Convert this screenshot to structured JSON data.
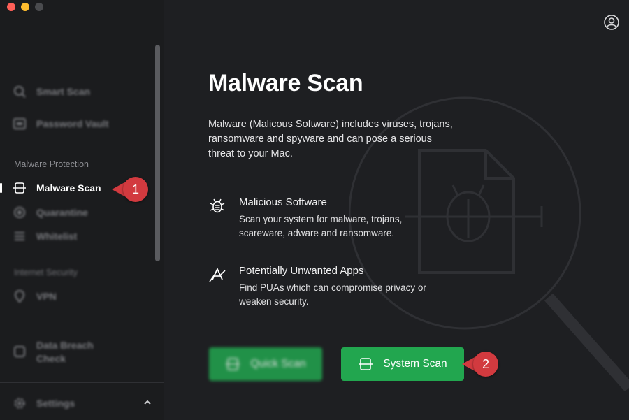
{
  "sidebar": {
    "top_items": [
      {
        "label": "Smart Scan",
        "icon": "search-icon"
      },
      {
        "label": "Password Vault",
        "icon": "vault-icon"
      }
    ],
    "section_malware": "Malware Protection",
    "malware_items": [
      {
        "label": "Malware Scan",
        "icon": "scanner-icon",
        "active": true
      },
      {
        "label": "Quarantine",
        "icon": "quarantine-icon"
      },
      {
        "label": "Whitelist",
        "icon": "list-icon"
      }
    ],
    "section_internet": "Internet Security",
    "internet_items": [
      {
        "label": "VPN",
        "icon": "location-pin-icon"
      }
    ],
    "breach_item": {
      "label_line1": "Data Breach",
      "label_line2": "Check",
      "icon": "breach-icon"
    },
    "settings": {
      "label": "Settings",
      "icon": "gear-icon",
      "toggle_icon": "chevron-up-icon"
    }
  },
  "main": {
    "title": "Malware Scan",
    "description": "Malware (Malicous Software) includes viruses, trojans, ransomware and spyware and can pose a serious threat to your Mac.",
    "features": [
      {
        "icon": "bug-icon",
        "title": "Malicious Software",
        "description": "Scan your system for malware, trojans, scareware, adware and ransomware."
      },
      {
        "icon": "app-warning-icon",
        "title": "Potentially Unwanted Apps",
        "description": "Find PUAs which can compromise privacy or weaken security."
      }
    ],
    "buttons": {
      "quick_scan": "Quick Scan",
      "system_scan": "System Scan"
    }
  },
  "callouts": {
    "first": "1",
    "second": "2"
  },
  "colors": {
    "background": "#1e1f22",
    "sidebar": "#1b1c1e",
    "accent_green": "#22a64f",
    "callout_red": "#d23a3f"
  }
}
